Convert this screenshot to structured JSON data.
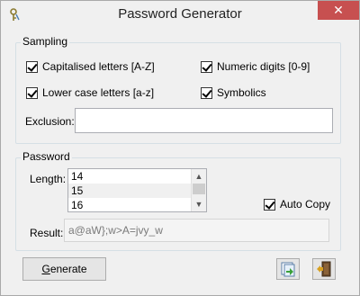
{
  "window": {
    "title": "Password Generator",
    "close_glyph": "✕"
  },
  "sampling": {
    "label": "Sampling",
    "capital": {
      "label": "Capitalised letters [A-Z]",
      "checked": true
    },
    "numeric": {
      "label": "Numeric digits [0-9]",
      "checked": true
    },
    "lower": {
      "label": "Lower case letters [a-z]",
      "checked": true
    },
    "symbolics": {
      "label": "Symbolics",
      "checked": true
    },
    "exclusion_label": "Exclusion:",
    "exclusion_value": ""
  },
  "password": {
    "label": "Password",
    "length_label": "Length:",
    "length_items": [
      "14",
      "15",
      "16"
    ],
    "length_selected": "15",
    "auto_copy": {
      "label": "Auto Copy",
      "checked": true
    },
    "result_label": "Result:",
    "result_value": "a@aW};w>A=jvy_w"
  },
  "buttons": {
    "generate_prefix": "G",
    "generate_rest": "enerate"
  },
  "icons": {
    "app": "key-icon",
    "copy": "copy-icon",
    "exit": "exit-door-icon"
  }
}
